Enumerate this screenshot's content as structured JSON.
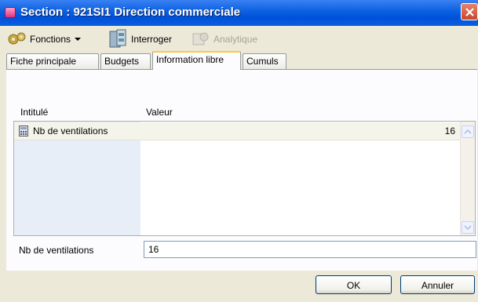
{
  "window": {
    "title": "Section : 921SI1 Direction commerciale"
  },
  "toolbar": {
    "functions_label": "Fonctions",
    "query_label": "Interroger",
    "analytics_label": "Analytique"
  },
  "tabs": [
    {
      "label": "Fiche principale"
    },
    {
      "label": "Budgets"
    },
    {
      "label": "Information libre"
    },
    {
      "label": "Cumuls"
    }
  ],
  "active_tab": "Information libre",
  "grid": {
    "columns": [
      "Intitulé",
      "Valeur"
    ],
    "rows": [
      {
        "label": "Nb de ventilations",
        "value": "16"
      }
    ]
  },
  "detail": {
    "label": "Nb de ventilations",
    "value": "16"
  },
  "buttons": {
    "ok": "OK",
    "cancel": "Annuler"
  },
  "colors": {
    "titlebar": "#0A5FE0",
    "active_tab_accent": "#FFC83C",
    "close": "#C8462B"
  },
  "icons": {
    "title": "section-icon",
    "functions": "gears-icon",
    "query": "cabinet-icon",
    "analytics": "gears-disabled-icon",
    "row": "calculator-icon"
  }
}
